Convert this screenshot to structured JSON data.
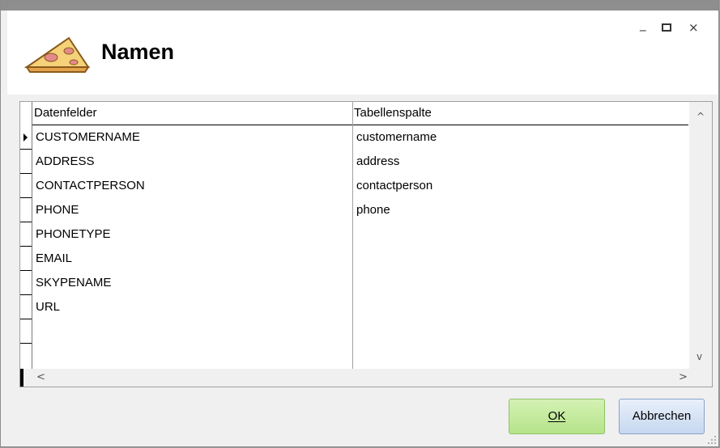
{
  "window": {
    "title": "Namen",
    "icon": "cheese-wedge-icon",
    "controls": {
      "minimize": "_",
      "maximize": "□",
      "close": "×"
    }
  },
  "grid": {
    "columns": [
      "Datenfelder",
      "Tabellenspalte"
    ],
    "rows": [
      {
        "field": "CUSTOMERNAME",
        "column": "customername",
        "current": true
      },
      {
        "field": "ADDRESS",
        "column": "address"
      },
      {
        "field": "CONTACTPERSON",
        "column": "contactperson"
      },
      {
        "field": "PHONE",
        "column": "phone"
      },
      {
        "field": "PHONETYPE",
        "column": ""
      },
      {
        "field": "EMAIL",
        "column": ""
      },
      {
        "field": "SKYPENAME",
        "column": ""
      },
      {
        "field": "URL",
        "column": ""
      },
      {
        "field": "",
        "column": ""
      },
      {
        "field": "",
        "column": ""
      }
    ],
    "scroll": {
      "up": "^",
      "down": "v",
      "left": "<",
      "right": ">"
    }
  },
  "buttons": {
    "ok": {
      "label": "OK",
      "mnemonic": "O"
    },
    "cancel": {
      "label": "Abbrechen",
      "mnemonic": "A"
    }
  },
  "colors": {
    "ok_bg": "#b6e38a",
    "cancel_bg": "#c6d7ef",
    "background": "#f0f0f0"
  }
}
